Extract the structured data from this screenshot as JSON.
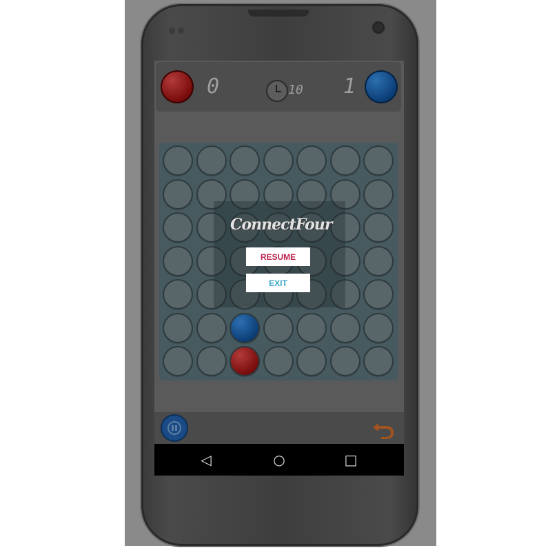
{
  "scoreboard": {
    "red_score": "0",
    "blue_score": "1",
    "timer": "10"
  },
  "board": {
    "rows": 7,
    "cols": 7,
    "discs": [
      {
        "row": 5,
        "col": 2,
        "color": "blue"
      },
      {
        "row": 6,
        "col": 2,
        "color": "red"
      }
    ]
  },
  "pause_menu": {
    "logo_text": "ConnectFour",
    "resume_label": "RESUME",
    "exit_label": "EXIT"
  },
  "navbar": {
    "back_icon": "◁",
    "home_icon": "○",
    "recents_icon": "□"
  },
  "colors": {
    "red_player": "#7a0d0d",
    "blue_player": "#0c3f78",
    "resume_text": "#c02650",
    "exit_text": "#3aa6c8"
  },
  "icons": [
    "stopwatch-icon",
    "pause-icon",
    "undo-icon",
    "back-icon",
    "home-icon",
    "recents-icon"
  ]
}
